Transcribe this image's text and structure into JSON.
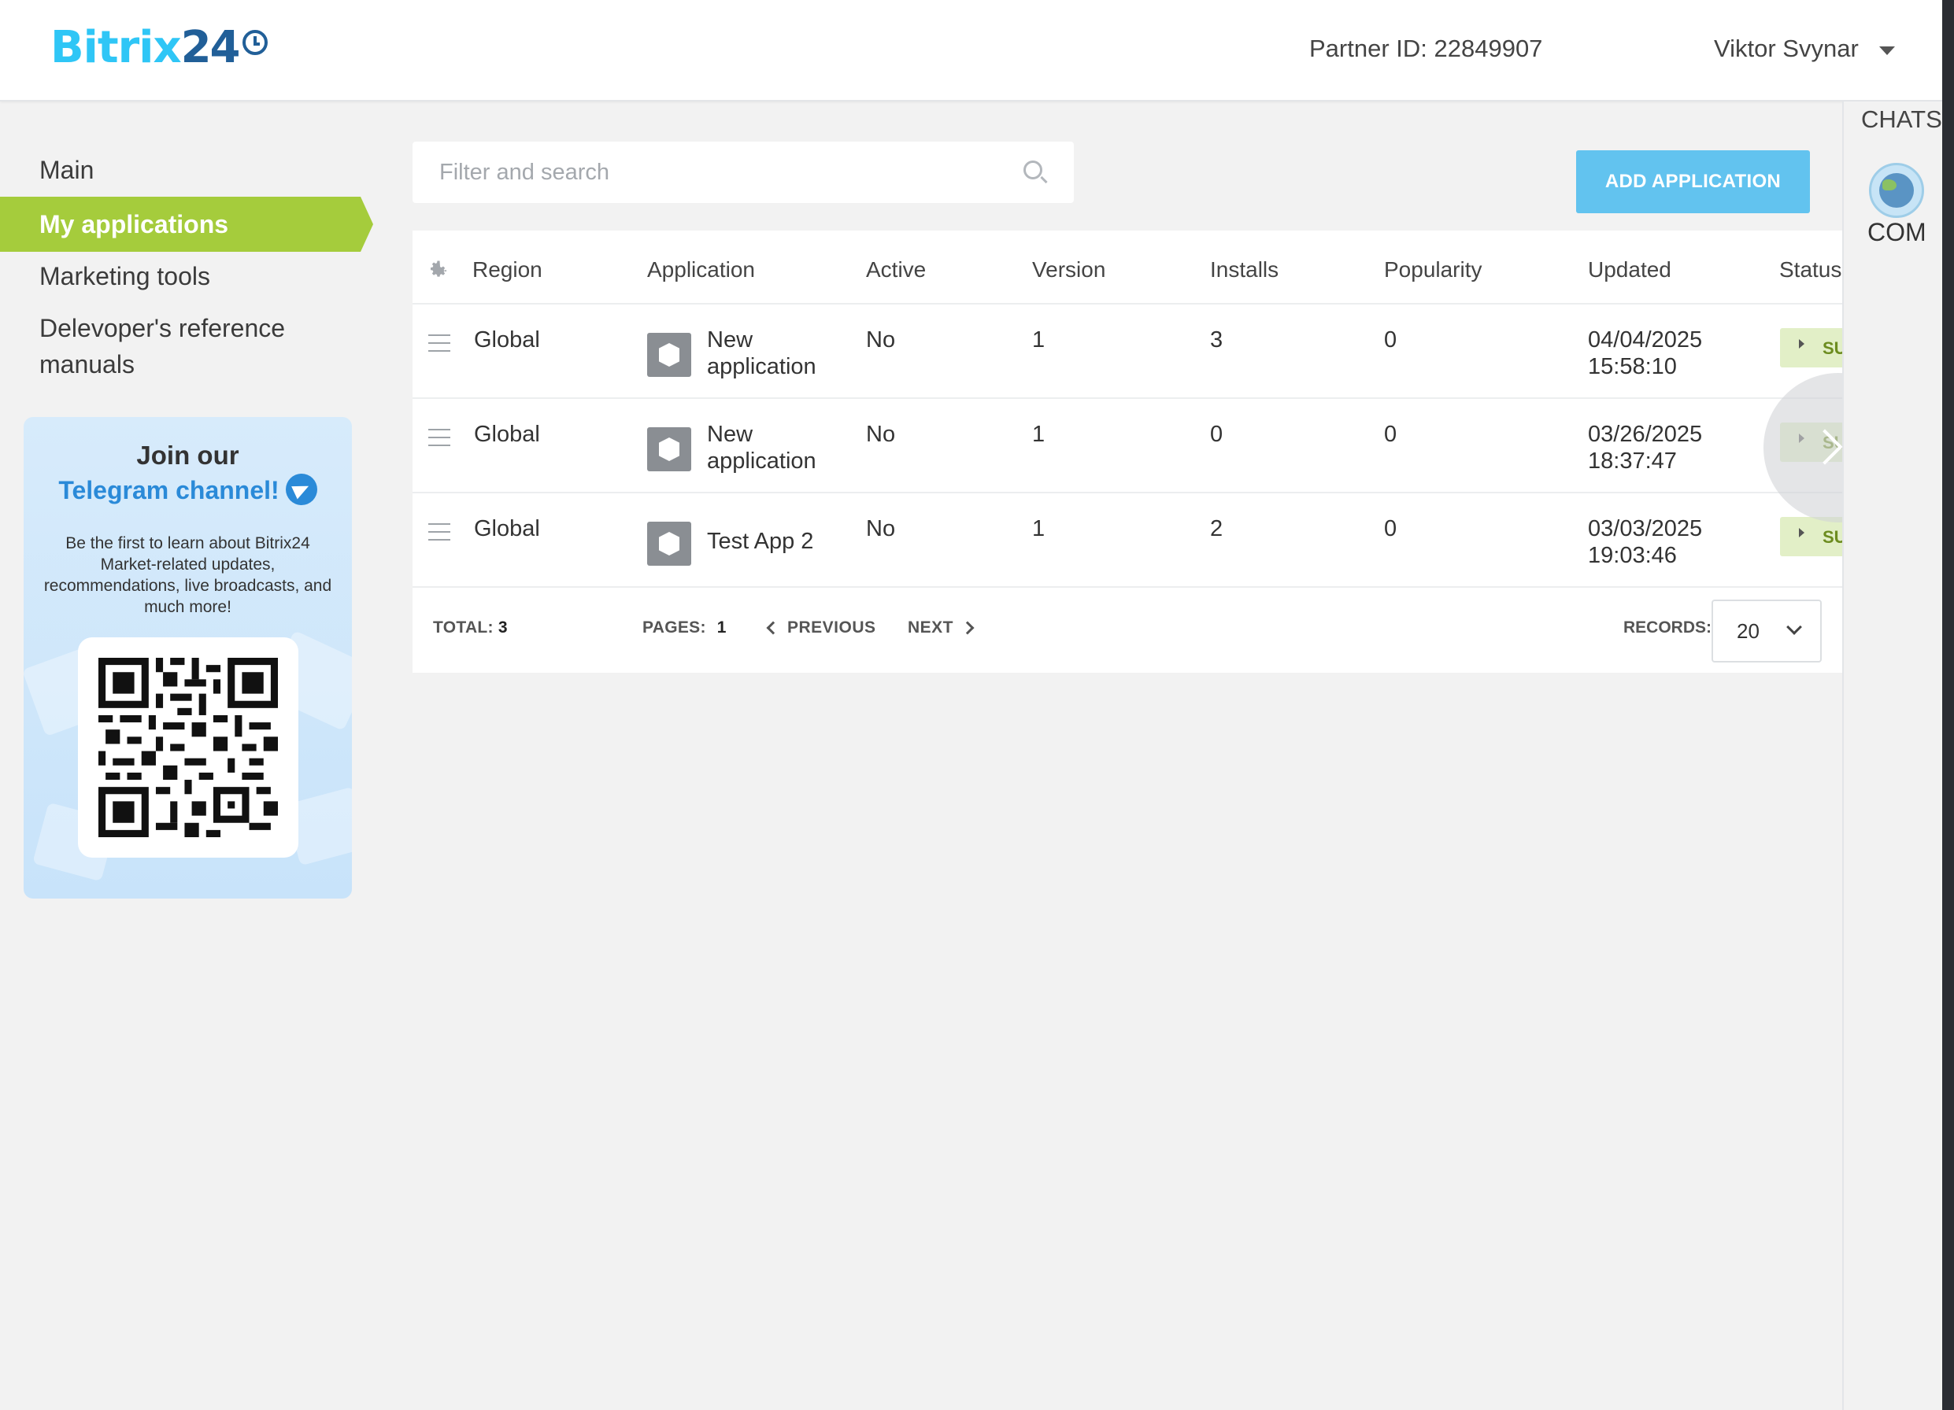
{
  "header": {
    "logo_part1": "Bitrix",
    "logo_part2": "24",
    "partner_id": "Partner ID: 22849907",
    "user_name": "Viktor Svynar"
  },
  "sidebar": {
    "items": [
      {
        "label": "Main"
      },
      {
        "label": "My applications",
        "active": true
      },
      {
        "label": "Marketing tools"
      },
      {
        "label": "Delevoper's reference manuals"
      }
    ]
  },
  "promo": {
    "title_line1": "Join our",
    "title_line2": "Telegram channel!",
    "body": "Be the first to learn about Bitrix24 Market-related updates, recommendations, live broadcasts, and much more!"
  },
  "search": {
    "placeholder": "Filter and search"
  },
  "toolbar": {
    "add_application": "ADD APPLICATION"
  },
  "table": {
    "columns": [
      "Region",
      "Application",
      "Active",
      "Version",
      "Installs",
      "Popularity",
      "Updated",
      "Status"
    ],
    "rows": [
      {
        "region": "Global",
        "application": "New application",
        "active": "No",
        "version": "1",
        "installs": "3",
        "popularity": "0",
        "updated_date": "04/04/2025",
        "updated_time": "15:58:10",
        "status": "SU"
      },
      {
        "region": "Global",
        "application": "New application",
        "active": "No",
        "version": "1",
        "installs": "0",
        "popularity": "0",
        "updated_date": "03/26/2025",
        "updated_time": "18:37:47",
        "status": "SU"
      },
      {
        "region": "Global",
        "application": "Test App 2",
        "active": "No",
        "version": "1",
        "installs": "2",
        "popularity": "0",
        "updated_date": "03/03/2025",
        "updated_time": "19:03:46",
        "status": "SU"
      }
    ]
  },
  "footer": {
    "total_label": "TOTAL:",
    "total_value": "3",
    "pages_label": "PAGES:",
    "pages_value": "1",
    "previous": "PREVIOUS",
    "next": "NEXT",
    "records_label": "RECORDS:",
    "records_value": "20"
  },
  "right_panel": {
    "chats": "CHATS",
    "com": "COM"
  },
  "colors": {
    "accent_green": "#a5cc3c",
    "button_blue": "#62c3ef",
    "logo_light": "#2fc6f6",
    "logo_dark": "#215f98",
    "status_bg": "#e2efc7"
  }
}
